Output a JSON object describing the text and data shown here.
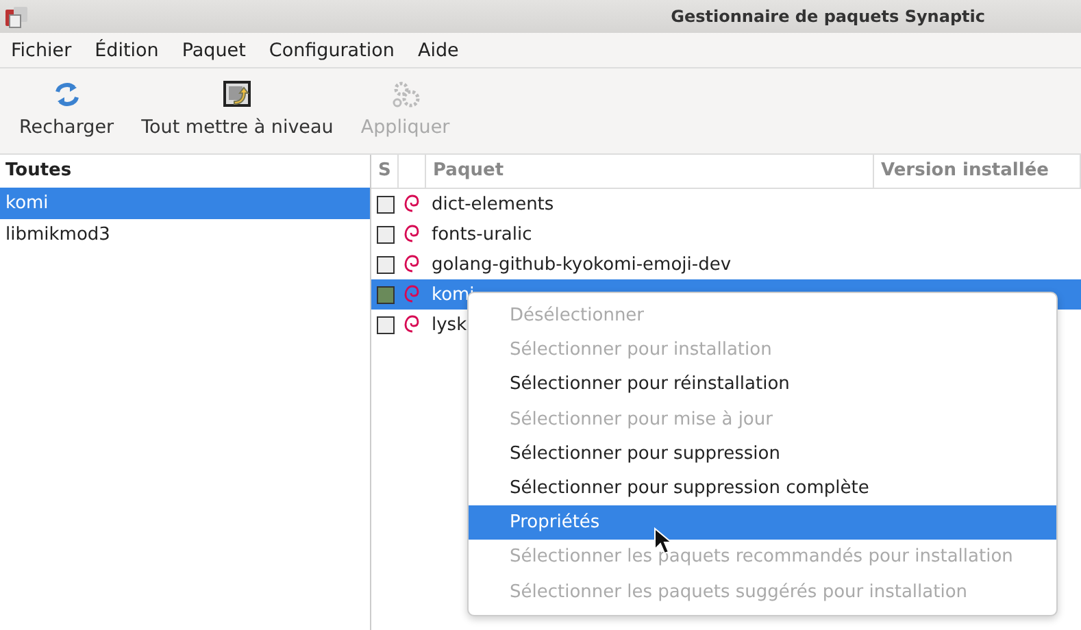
{
  "window": {
    "title": "Gestionnaire de paquets Synaptic"
  },
  "menubar": [
    "Fichier",
    "Édition",
    "Paquet",
    "Configuration",
    "Aide"
  ],
  "toolbar": [
    {
      "label": "Recharger",
      "kind": "reload",
      "disabled": false
    },
    {
      "label": "Tout mettre à niveau",
      "kind": "upgrade",
      "disabled": false
    },
    {
      "label": "Appliquer",
      "kind": "apply",
      "disabled": true
    }
  ],
  "sidebar": {
    "header": "Toutes",
    "items": [
      {
        "label": "komi",
        "selected": true
      },
      {
        "label": "libmikmod3",
        "selected": false
      }
    ]
  },
  "table": {
    "columns": [
      "S",
      "Paquet",
      "Version installée"
    ],
    "rows": [
      {
        "name": "dict-elements",
        "marked": false,
        "selected": false
      },
      {
        "name": "fonts-uralic",
        "marked": false,
        "selected": false
      },
      {
        "name": "golang-github-kyokomi-emoji-dev",
        "marked": false,
        "selected": false
      },
      {
        "name": "komi",
        "marked": true,
        "selected": true
      },
      {
        "name": "lysk",
        "marked": false,
        "selected": false
      }
    ]
  },
  "context_menu": {
    "items": [
      {
        "label": "Désélectionner",
        "disabled": true,
        "selected": false
      },
      {
        "label": "Sélectionner pour installation",
        "disabled": true,
        "selected": false
      },
      {
        "label": "Sélectionner pour réinstallation",
        "disabled": false,
        "selected": false
      },
      {
        "label": "Sélectionner pour mise à jour",
        "disabled": true,
        "selected": false
      },
      {
        "label": "Sélectionner pour suppression",
        "disabled": false,
        "selected": false
      },
      {
        "label": "Sélectionner pour suppression complète",
        "disabled": false,
        "selected": false
      },
      {
        "label": "Propriétés",
        "disabled": false,
        "selected": true
      },
      {
        "label": "Sélectionner les paquets recommandés pour installation",
        "disabled": true,
        "selected": false
      },
      {
        "label": "Sélectionner les paquets suggérés pour installation",
        "disabled": true,
        "selected": false
      }
    ]
  }
}
